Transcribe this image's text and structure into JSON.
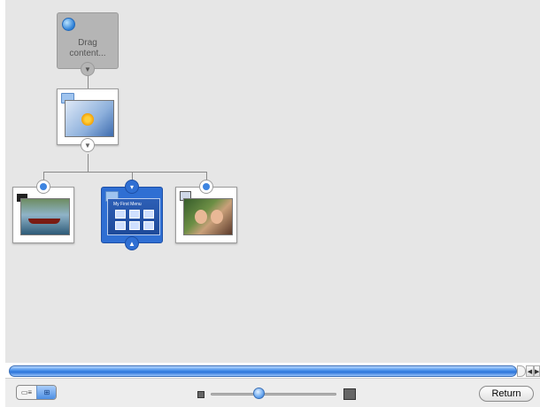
{
  "canvas": {
    "first_node_label": "Drag content...",
    "first_node_icon": "globe-icon",
    "nodes": [
      "main-menu",
      "movie-clip",
      "submenu-selected",
      "slideshow"
    ]
  },
  "scroll": {
    "left_arrow": "◀",
    "right_arrow": "▶"
  },
  "toolbar": {
    "view_standard": "▭≡",
    "view_map": "⊞",
    "map_view_selected": true,
    "zoom_level": 0.38,
    "return_label": "Return"
  },
  "thumbnails": {
    "submenu_header": "My First Menu"
  },
  "colors": {
    "background": "#e6e6e6",
    "selection_blue": "#2f6fd3",
    "scrollbar_blue": "#4f94ec"
  }
}
